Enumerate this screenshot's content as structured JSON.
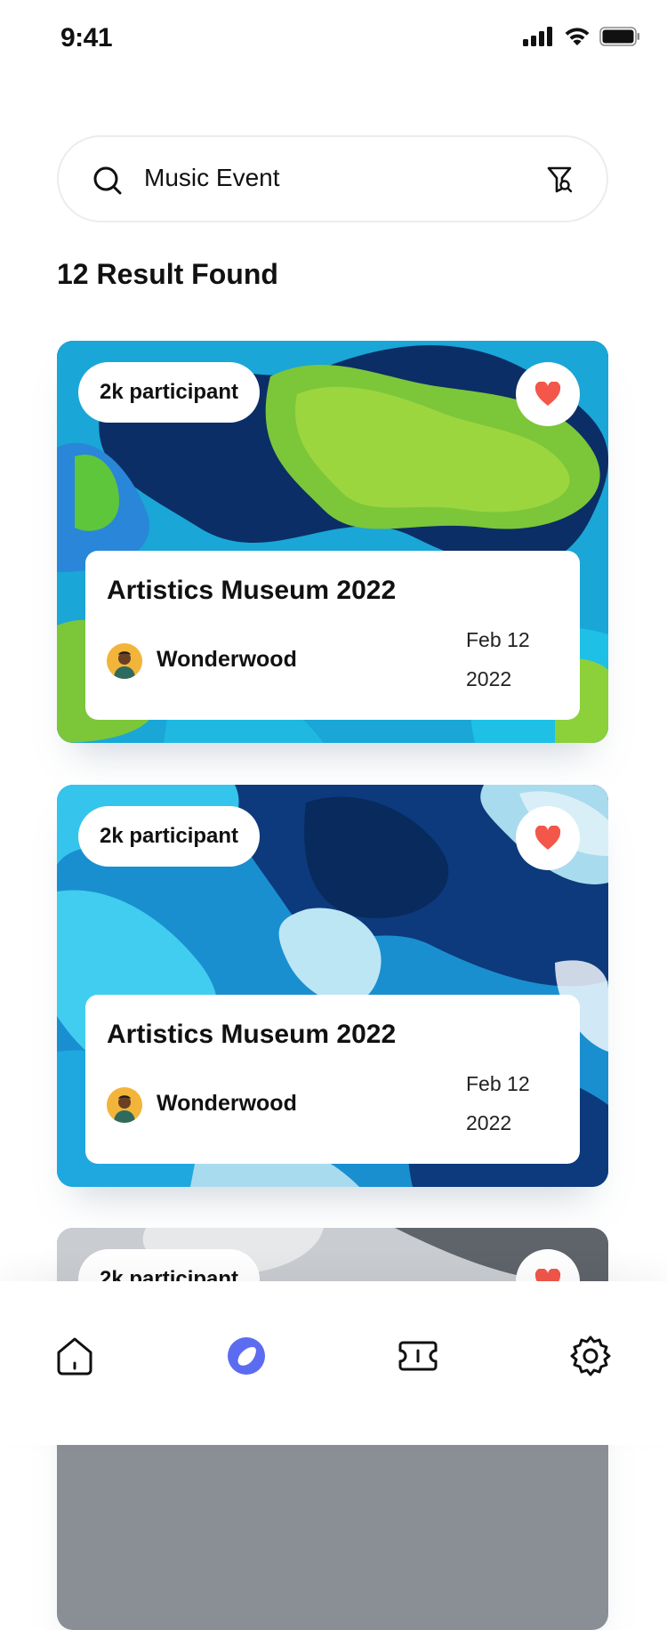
{
  "status_bar": {
    "time": "9:41"
  },
  "search": {
    "query": "Music Event"
  },
  "results": {
    "title": "12 Result Found"
  },
  "events": [
    {
      "participants": "2k participant",
      "title": "Artistics Museum 2022",
      "organizer": "Wonderwood",
      "date_line1": "Feb 12",
      "date_line2": "2022",
      "theme": "green-blue"
    },
    {
      "participants": "2k participant",
      "title": "Artistics Museum 2022",
      "organizer": "Wonderwood",
      "date_line1": "Feb 12",
      "date_line2": "2022",
      "theme": "blue"
    },
    {
      "participants": "2k participant",
      "title": "",
      "organizer": "",
      "date_line1": "",
      "date_line2": "",
      "theme": "gray"
    }
  ],
  "tab_bar": {
    "items": [
      {
        "icon": "home-icon"
      },
      {
        "icon": "explore-icon",
        "active": true
      },
      {
        "icon": "ticket-icon"
      },
      {
        "icon": "settings-icon"
      }
    ]
  },
  "colors": {
    "accent": "#5B6CF0",
    "heart": "#F2574A"
  }
}
